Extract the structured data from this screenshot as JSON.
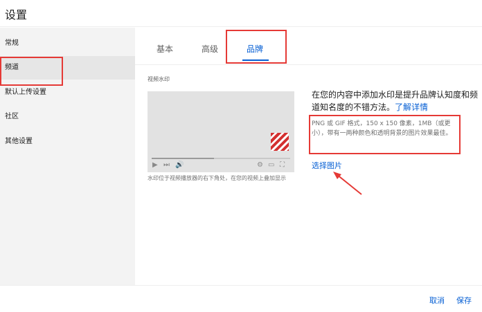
{
  "dialog": {
    "title": "设置"
  },
  "sidebar": {
    "items": [
      {
        "label": "常规"
      },
      {
        "label": "频道"
      },
      {
        "label": "默认上传设置"
      },
      {
        "label": "社区"
      },
      {
        "label": "其他设置"
      }
    ],
    "active_index": 1
  },
  "tabs": [
    {
      "label": "基本"
    },
    {
      "label": "高级"
    },
    {
      "label": "品牌"
    }
  ],
  "active_tab_index": 2,
  "watermark": {
    "section_label": "视频水印",
    "player_caption": "水印位于视频播放器的右下角处，在您的视频上叠加显示",
    "description": "在您的内容中添加水印是提升品牌认知度和频道知名度的不错方法。",
    "learn_more": "了解详情",
    "requirements": "PNG 或 GIF 格式，150 x 150 像素，1MB（或更小），带有一两种颜色和透明背景的图片效果最佳。",
    "choose_image": "选择图片"
  },
  "player_controls": {
    "play_icon": "▶",
    "next_icon": "⏭",
    "volume_icon": "🔊",
    "settings_icon": "⚙",
    "theater_icon": "▭",
    "fullscreen_icon": "⛶",
    "progress": 0.45
  },
  "footer": {
    "cancel_label": "取消",
    "save_label": "保存"
  },
  "colors": {
    "accent": "#065fd4",
    "highlight": "#e53935",
    "watermark": "#d32f2f"
  }
}
